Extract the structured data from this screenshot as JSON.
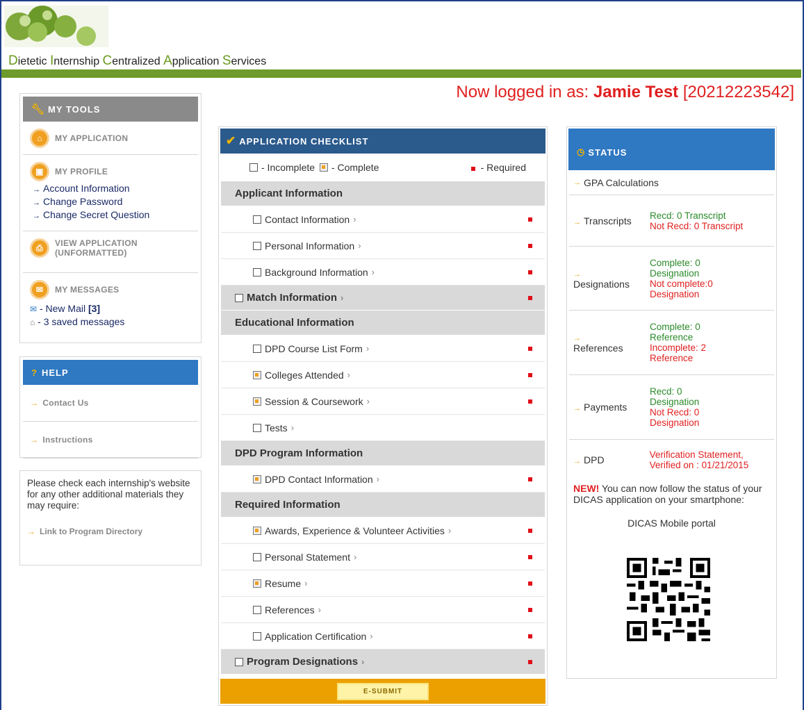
{
  "header": {
    "logo_words": [
      {
        "cap": "D",
        "rest": "ietetic "
      },
      {
        "cap": "I",
        "rest": "nternship "
      },
      {
        "cap": "C",
        "rest": "entralized "
      },
      {
        "cap": "A",
        "rest": "pplication "
      },
      {
        "cap": "S",
        "rest": "ervices"
      }
    ]
  },
  "login": {
    "prefix": "Now logged in as: ",
    "name": "Jamie Test",
    "id": " [20212223542]"
  },
  "tools": {
    "title": "MY TOOLS",
    "my_application": "MY APPLICATION",
    "my_profile": "MY PROFILE",
    "profile_links": [
      "Account Information",
      "Change Password",
      "Change Secret Question"
    ],
    "view_application_1": "VIEW APPLICATION",
    "view_application_2": "(UNFORMATTED)",
    "my_messages": "MY MESSAGES",
    "new_mail_prefix": " - New Mail ",
    "new_mail_count": "[3]",
    "saved_messages": " - 3 saved messages"
  },
  "help": {
    "title": "HELP",
    "contact": "Contact Us",
    "instructions": "Instructions"
  },
  "note": {
    "text": "Please check each internship's website for any other additional materials they may require:",
    "link": "Link to Program Directory"
  },
  "checklist": {
    "title": "APPLICATION CHECKLIST",
    "legend_incomplete": "- Incomplete",
    "legend_complete": "- Complete",
    "legend_required": "- Required",
    "applicant_info": "Applicant Information",
    "contact_info": "Contact Information",
    "personal_info": "Personal Information",
    "background_info": "Background Information",
    "match_info": "Match Information",
    "educational_info": "Educational Information",
    "dpd_course": "DPD Course List Form",
    "colleges": "Colleges Attended",
    "session": "Session & Coursework",
    "tests": "Tests",
    "dpd_program": "DPD Program Information",
    "dpd_contact": "DPD Contact Information",
    "required_info": "Required Information",
    "awards": "Awards, Experience & Volunteer Activities",
    "personal_statement": "Personal Statement",
    "resume": "Resume",
    "references": "References",
    "certification": "Application Certification",
    "program_designations": "Program Designations",
    "submit": "E-SUBMIT"
  },
  "status": {
    "title": "STATUS",
    "gpa": "GPA Calculations",
    "transcripts": "Transcripts",
    "transcripts_recd": "Recd: 0  Transcript",
    "transcripts_not": "Not Recd: 0 Transcript",
    "designations": "Designations",
    "designations_complete": "Complete: 0 Designation",
    "designations_not": "Not complete:0 Designation",
    "references": "References",
    "references_complete": "Complete: 0 Reference",
    "references_incomplete": "Incomplete: 2 Reference",
    "payments": "Payments",
    "payments_recd": "Recd: 0 Designation",
    "payments_not": "Not Recd: 0 Designation",
    "dpd": "DPD",
    "dpd_value": "Verification Statement, Verified on : 01/21/2015",
    "new_label": "NEW!",
    "new_text": "   You can now follow the status of your DICAS application on your smartphone:",
    "mobile_portal": "DICAS Mobile portal"
  },
  "colors": {
    "accent_green": "#6e9b2c",
    "checklist_blue": "#2b5a8c",
    "status_blue": "#2f78c2",
    "submit_orange": "#eba000",
    "required_red": "#e0101a"
  }
}
